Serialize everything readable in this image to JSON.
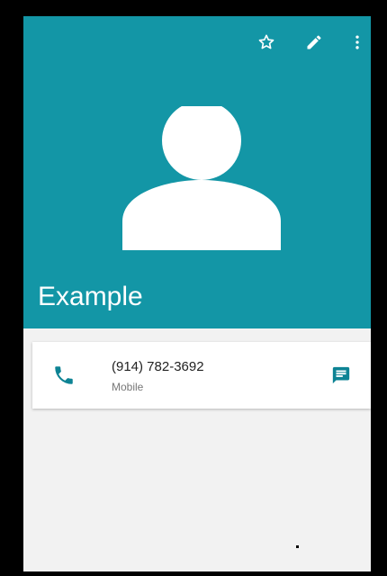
{
  "toolbar": {
    "icons": [
      "star-outline-icon",
      "edit-icon",
      "more-vert-icon"
    ]
  },
  "contact": {
    "name": "Example",
    "avatar_icon": "person-icon"
  },
  "phone_entry": {
    "number": "(914) 782-3692",
    "type": "Mobile",
    "call_icon": "phone-icon",
    "message_icon": "message-icon"
  },
  "colors": {
    "header": "#1396a6",
    "accent": "#0d8394",
    "background": "#f2f2f2"
  }
}
